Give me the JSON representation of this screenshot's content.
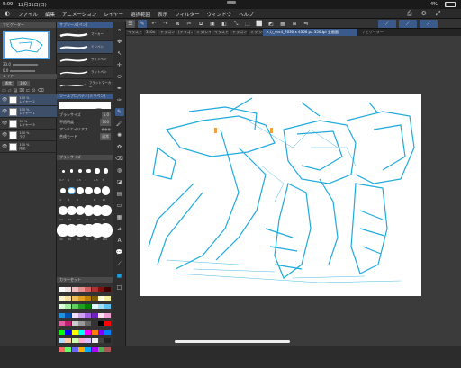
{
  "status": {
    "time": "5:09",
    "date": "12月31日(日)",
    "battery": "4%"
  },
  "menu": {
    "items": [
      "ファイル",
      "編集",
      "アニメーション",
      "レイヤー",
      "選択範囲",
      "表示",
      "フィルター",
      "ウィンドウ",
      "ヘルプ"
    ]
  },
  "tabs": {
    "items": [
      "イラスト1(320x",
      "320x",
      "ドラゴン(レイヤー)",
      "(ドラゴン",
      "ミラ(レイヤー)",
      "イラスト(レイヤー)",
      "ドラゴン(シャドウ)",
      "ミラ(シャドウ)"
    ],
    "active": "メカ_ver4_7630 x 4366 px 350dpi 全画面",
    "navigator": "ナビゲーター"
  },
  "left": {
    "navigator_label": "ナビゲーター",
    "zoom": "33.0",
    "angle": "0.0",
    "layer_header": "レイヤー",
    "blend": "通常",
    "opacity": "100",
    "layers": [
      {
        "pct": "100 %",
        "name": "レイヤー 2"
      },
      {
        "pct": "100 %",
        "name": "レイヤー 1"
      },
      {
        "pct": "34 %",
        "name": "レイヤー 3"
      },
      {
        "pct": "100 %",
        "name": "ラフ"
      },
      {
        "pct": "100 %",
        "name": "用紙"
      }
    ]
  },
  "sub": {
    "brush_header": "サブツール[ペン]",
    "brushes": [
      "マーカー",
      "ミリペン",
      "サインペン",
      "ラットペン",
      "フラットマーカー"
    ],
    "prop_header": "ツールプロパティ[ミリペン]",
    "brush_size_label": "ブラシサイズ",
    "brush_size": "5.0",
    "opacity_label": "不透明度",
    "opacity": "100",
    "antialias_label": "アンチエイリアス",
    "blend_label": "合成モード",
    "blend_value": "通常",
    "brush_sizes_header": "ブラシサイズ",
    "brush_size_values": [
      "0.7",
      "1",
      "1.5",
      "2",
      "2.5",
      "3",
      "4",
      "5",
      "6",
      "7",
      "8",
      "10",
      "12",
      "15",
      "17",
      "20",
      "25",
      "30",
      "40",
      "50",
      "60",
      "70",
      "80",
      "100"
    ],
    "color_header": "カラーセット"
  },
  "colors": {
    "accent": "#4aa3e8",
    "sketch": "#1eaadd",
    "panel": "#363636"
  }
}
